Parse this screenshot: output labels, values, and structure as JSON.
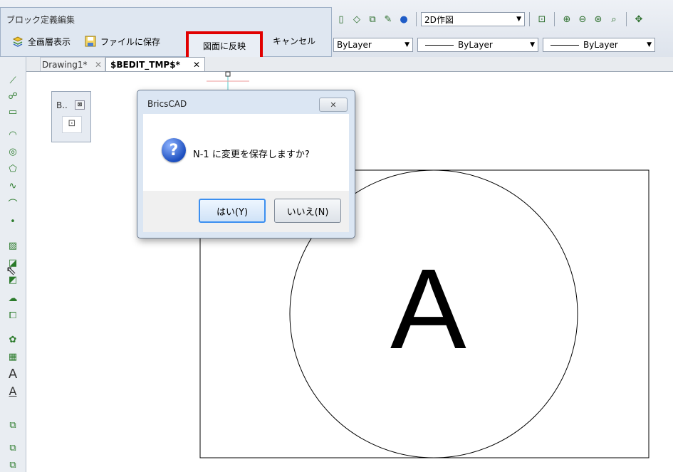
{
  "block_editor": {
    "title": "ブロック定義編集",
    "buttons": [
      {
        "label": "全画層表示",
        "icon": "layers-icon"
      },
      {
        "label": "ファイルに保存",
        "icon": "save-icon"
      },
      {
        "label": "図面に反映",
        "icon": "none"
      },
      {
        "label": "キャンセル",
        "icon": "none"
      }
    ]
  },
  "toolbar": {
    "workspace_combo": "2D作図",
    "layer_combo": "ByLayer",
    "linetype_combo": "ByLayer",
    "lineweight_combo": "ByLayer"
  },
  "tabs": [
    {
      "label": "Drawing1*",
      "close": "✕"
    },
    {
      "label": "$BEDIT_TMP$*",
      "close": "✕"
    }
  ],
  "mini_panel": {
    "title": "B..",
    "close": "⊠"
  },
  "dialog": {
    "title": "BricsCAD",
    "close_label": "✕",
    "message": "N-1 に変更を保存しますか?",
    "icon": "?",
    "yes_label": "はい(Y)",
    "no_label": "いいえ(N)"
  },
  "drawing": {
    "letter": "A"
  },
  "colors": {
    "highlight": "#e10000",
    "default_button_border": "#3c8ff0"
  }
}
